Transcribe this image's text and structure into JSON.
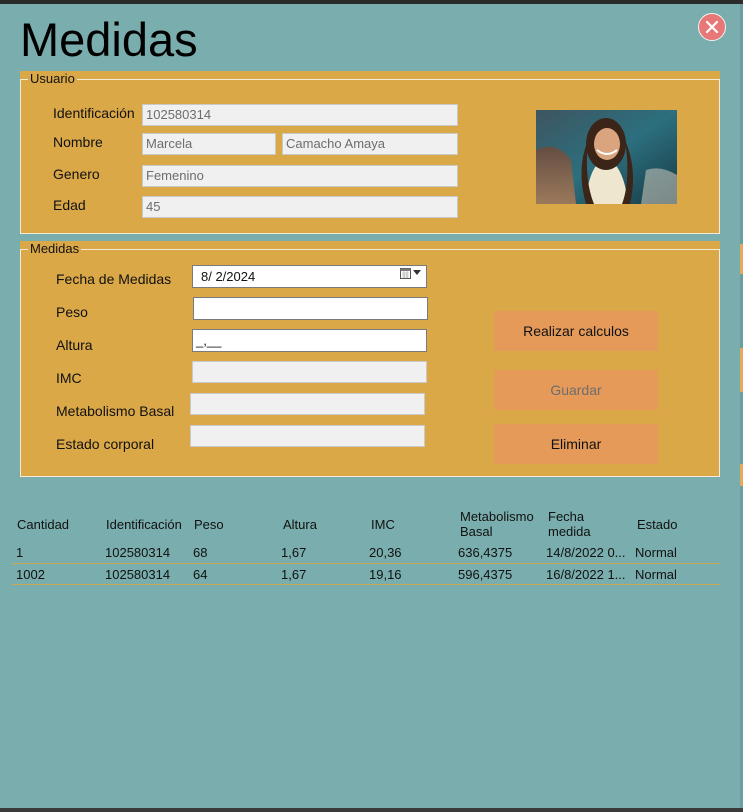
{
  "window": {
    "title": "Medidas"
  },
  "usuario": {
    "legend": "Usuario",
    "labels": {
      "identificacion": "Identificación",
      "nombre": "Nombre",
      "genero": "Genero",
      "edad": "Edad"
    },
    "values": {
      "identificacion": "102580314",
      "nombre": "Marcela",
      "apellidos": "Camacho Amaya",
      "genero": "Femenino",
      "edad": "45"
    }
  },
  "medidas": {
    "legend": "Medidas",
    "labels": {
      "fecha": "Fecha de Medidas",
      "peso": "Peso",
      "altura": "Altura",
      "imc": "IMC",
      "metabolismo": "Metabolismo Basal",
      "estado": "Estado corporal"
    },
    "values": {
      "fecha": "8/  2/2024",
      "peso": "",
      "altura": "_,__",
      "imc": "",
      "metabolismo": "",
      "estado": ""
    },
    "buttons": {
      "calcular": "Realizar calculos",
      "guardar": "Guardar",
      "eliminar": "Eliminar"
    }
  },
  "table": {
    "headers": {
      "cantidad": "Cantidad",
      "identificacion": "Identificación",
      "peso": "Peso",
      "altura": "Altura",
      "imc": "IMC",
      "metabolismo_l1": "Metabolismo",
      "metabolismo_l2": "Basal",
      "fecha_l1": "Fecha",
      "fecha_l2": "medida",
      "estado": "Estado"
    },
    "rows": [
      {
        "cantidad": "1",
        "identificacion": "102580314",
        "peso": "68",
        "altura": "1,67",
        "imc": "20,36",
        "metabolismo": "636,4375",
        "fecha": "14/8/2022 0...",
        "estado": "Normal"
      },
      {
        "cantidad": "1002",
        "identificacion": "102580314",
        "peso": "64",
        "altura": "1,67",
        "imc": "19,16",
        "metabolismo": "596,4375",
        "fecha": "16/8/2022 1...",
        "estado": "Normal"
      }
    ]
  },
  "icons": {
    "close": "close-icon",
    "calendar": "calendar-icon",
    "dropdown": "chevron-down-icon"
  },
  "colors": {
    "background": "#7AADAD",
    "panel": "#DBA848",
    "button": "#E59A5A",
    "close": "#E87878"
  }
}
